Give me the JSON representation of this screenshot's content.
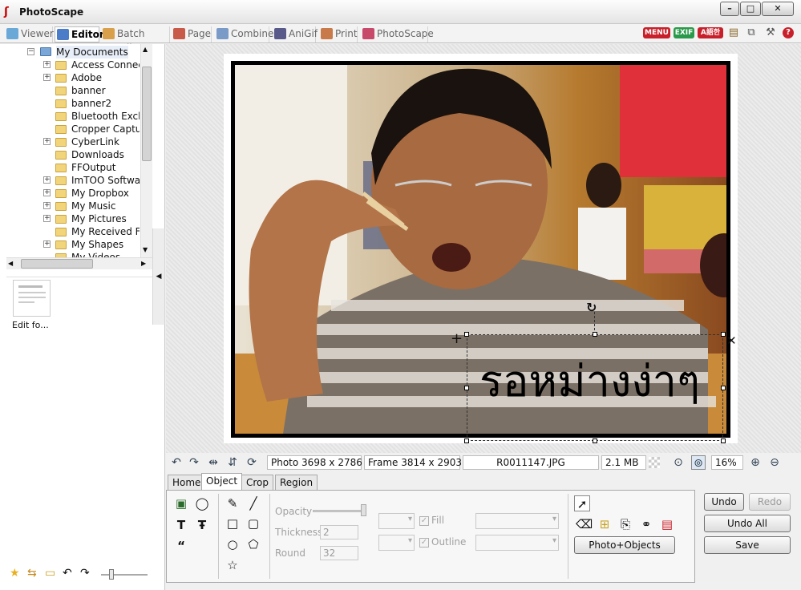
{
  "window": {
    "title": "PhotoScape"
  },
  "tabs": [
    {
      "label": "Viewer"
    },
    {
      "label": "Editor"
    },
    {
      "label": "Batch Editor"
    },
    {
      "label": "Page"
    },
    {
      "label": "Combine"
    },
    {
      "label": "AniGif"
    },
    {
      "label": "Print"
    },
    {
      "label": "PhotoScape"
    }
  ],
  "topbar_badges": {
    "menu": "MENU",
    "exif": "EXIF",
    "lang": "A語한"
  },
  "tree": {
    "root": "My Documents",
    "items": [
      {
        "label": "Access Connections"
      },
      {
        "label": "Adobe"
      },
      {
        "label": "banner"
      },
      {
        "label": "banner2"
      },
      {
        "label": "Bluetooth Exchange"
      },
      {
        "label": "Cropper Captures"
      },
      {
        "label": "CyberLink"
      },
      {
        "label": "Downloads"
      },
      {
        "label": "FFOutput"
      },
      {
        "label": "ImTOO Software"
      },
      {
        "label": "My Dropbox"
      },
      {
        "label": "My Music"
      },
      {
        "label": "My Pictures"
      },
      {
        "label": "My Received Files"
      },
      {
        "label": "My Shapes"
      },
      {
        "label": "My Videos"
      }
    ]
  },
  "thumbnail": {
    "caption": "Edit fo..."
  },
  "canvas": {
    "handwriting": "รอหม่างง่าๆ",
    "rotate_glyph": "↻",
    "close_glyph": "✕",
    "move_glyph": "+"
  },
  "status": {
    "photo_size": "Photo 3698 x 2786",
    "frame_size": "Frame 3814 x 2903",
    "filename": "R0011147.JPG",
    "filesize": "2.1 MB",
    "zoom": "16%"
  },
  "panel_tabs": [
    {
      "label": "Home"
    },
    {
      "label": "Object"
    },
    {
      "label": "Crop"
    },
    {
      "label": "Region"
    }
  ],
  "object_panel": {
    "opacity_label": "Opacity",
    "opacity_value": 1.0,
    "thickness_label": "Thickness",
    "thickness_value": "2",
    "round_label": "Round",
    "round_value": "32",
    "fill_label": "Fill",
    "outline_label": "Outline",
    "photo_objects_label": "Photo+Objects"
  },
  "actions": {
    "undo": "Undo",
    "redo": "Redo",
    "undo_all": "Undo All",
    "save": "Save"
  }
}
